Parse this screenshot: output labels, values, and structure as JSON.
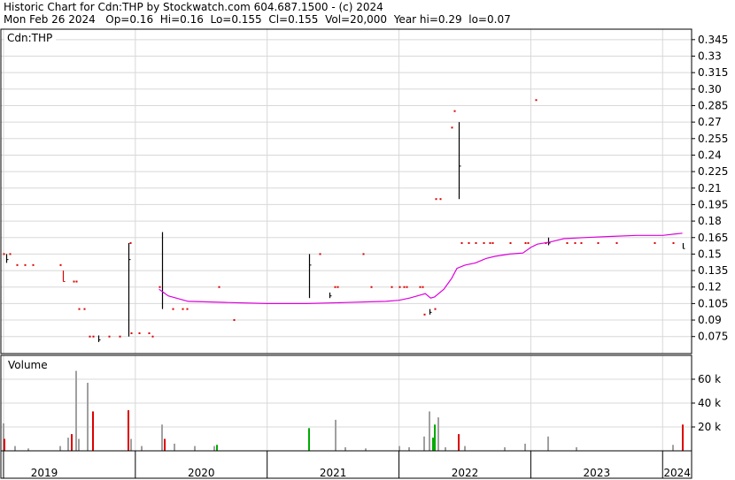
{
  "header": {
    "line1": "Historic Chart for Cdn:THP by Stockwatch.com 604.687.1500 - (c) 2024",
    "line2": "Mon Feb 26 2024   Op=0.16  Hi=0.16  Lo=0.155  Cl=0.155  Vol=20,000  Year hi=0.29  lo=0.07"
  },
  "colors": {
    "up": "#00aa00",
    "down": "#dd0000",
    "neutral": "#000000",
    "volume_neutral": "#a0a0a0",
    "moving_average": "#dd00dd",
    "grid": "#d8d8d8",
    "frame": "#000000"
  },
  "chart_data": [
    {
      "type": "line",
      "panel": "price",
      "label": "Cdn:THP",
      "y_ticks": [
        "0.345",
        "0.33",
        "0.315",
        "0.30",
        "0.285",
        "0.27",
        "0.255",
        "0.24",
        "0.225",
        "0.21",
        "0.195",
        "0.18",
        "0.165",
        "0.15",
        "0.135",
        "0.12",
        "0.105",
        "0.09",
        "0.075"
      ],
      "ylim": [
        0.0595,
        0.3545
      ],
      "xlim": [
        2018.98,
        2024.22
      ],
      "x_labels": [
        "2019",
        "2020",
        "2021",
        "2022",
        "2023",
        "2024"
      ],
      "year_boundaries": [
        2019,
        2020,
        2021,
        2022,
        2023,
        2024
      ],
      "grid": true,
      "bars": [
        {
          "t": 2019.0,
          "lo": 0.15,
          "hi": 0.15,
          "cl": 0.15,
          "dir": "down"
        },
        {
          "t": 2019.02,
          "lo": 0.142,
          "hi": 0.15,
          "cl": 0.145,
          "dir": "neutral"
        },
        {
          "t": 2019.05,
          "lo": 0.15,
          "hi": 0.15,
          "cl": 0.15,
          "dir": "down"
        },
        {
          "t": 2019.1,
          "lo": 0.14,
          "hi": 0.14,
          "cl": 0.14,
          "dir": "down"
        },
        {
          "t": 2019.16,
          "lo": 0.14,
          "hi": 0.14,
          "cl": 0.14,
          "dir": "down"
        },
        {
          "t": 2019.22,
          "lo": 0.14,
          "hi": 0.14,
          "cl": 0.14,
          "dir": "down"
        },
        {
          "t": 2019.43,
          "lo": 0.14,
          "hi": 0.14,
          "cl": 0.14,
          "dir": "down"
        },
        {
          "t": 2019.45,
          "lo": 0.125,
          "hi": 0.135,
          "cl": 0.125,
          "dir": "down"
        },
        {
          "t": 2019.53,
          "lo": 0.125,
          "hi": 0.125,
          "cl": 0.125,
          "dir": "down"
        },
        {
          "t": 2019.55,
          "lo": 0.125,
          "hi": 0.125,
          "cl": 0.125,
          "dir": "down"
        },
        {
          "t": 2019.57,
          "lo": 0.1,
          "hi": 0.1,
          "cl": 0.1,
          "dir": "down"
        },
        {
          "t": 2019.61,
          "lo": 0.1,
          "hi": 0.1,
          "cl": 0.1,
          "dir": "down"
        },
        {
          "t": 2019.65,
          "lo": 0.075,
          "hi": 0.075,
          "cl": 0.075,
          "dir": "down"
        },
        {
          "t": 2019.68,
          "lo": 0.075,
          "hi": 0.075,
          "cl": 0.075,
          "dir": "down"
        },
        {
          "t": 2019.72,
          "lo": 0.07,
          "hi": 0.076,
          "cl": 0.072,
          "dir": "neutral"
        },
        {
          "t": 2019.8,
          "lo": 0.075,
          "hi": 0.075,
          "cl": 0.075,
          "dir": "down"
        },
        {
          "t": 2019.88,
          "lo": 0.075,
          "hi": 0.075,
          "cl": 0.075,
          "dir": "down"
        },
        {
          "t": 2019.95,
          "lo": 0.075,
          "hi": 0.16,
          "cl": 0.145,
          "dir": "neutral"
        },
        {
          "t": 2019.96,
          "lo": 0.16,
          "hi": 0.16,
          "cl": 0.16,
          "dir": "down"
        },
        {
          "t": 2019.97,
          "lo": 0.078,
          "hi": 0.078,
          "cl": 0.078,
          "dir": "down"
        },
        {
          "t": 2020.03,
          "lo": 0.078,
          "hi": 0.078,
          "cl": 0.078,
          "dir": "down"
        },
        {
          "t": 2020.1,
          "lo": 0.078,
          "hi": 0.078,
          "cl": 0.078,
          "dir": "down"
        },
        {
          "t": 2020.13,
          "lo": 0.075,
          "hi": 0.075,
          "cl": 0.075,
          "dir": "down"
        },
        {
          "t": 2020.18,
          "lo": 0.12,
          "hi": 0.12,
          "cl": 0.12,
          "dir": "down"
        },
        {
          "t": 2020.2,
          "lo": 0.1,
          "hi": 0.17,
          "cl": 0.115,
          "dir": "neutral"
        },
        {
          "t": 2020.28,
          "lo": 0.1,
          "hi": 0.1,
          "cl": 0.1,
          "dir": "down"
        },
        {
          "t": 2020.36,
          "lo": 0.1,
          "hi": 0.1,
          "cl": 0.1,
          "dir": "down"
        },
        {
          "t": 2020.39,
          "lo": 0.1,
          "hi": 0.1,
          "cl": 0.1,
          "dir": "down"
        },
        {
          "t": 2020.63,
          "lo": 0.12,
          "hi": 0.12,
          "cl": 0.12,
          "dir": "down"
        },
        {
          "t": 2020.75,
          "lo": 0.09,
          "hi": 0.09,
          "cl": 0.09,
          "dir": "down"
        },
        {
          "t": 2021.32,
          "lo": 0.11,
          "hi": 0.15,
          "cl": 0.14,
          "dir": "neutral"
        },
        {
          "t": 2021.4,
          "lo": 0.15,
          "hi": 0.15,
          "cl": 0.15,
          "dir": "down"
        },
        {
          "t": 2021.47,
          "lo": 0.11,
          "hi": 0.115,
          "cl": 0.112,
          "dir": "neutral"
        },
        {
          "t": 2021.51,
          "lo": 0.12,
          "hi": 0.12,
          "cl": 0.12,
          "dir": "down"
        },
        {
          "t": 2021.53,
          "lo": 0.12,
          "hi": 0.12,
          "cl": 0.12,
          "dir": "down"
        },
        {
          "t": 2021.73,
          "lo": 0.15,
          "hi": 0.15,
          "cl": 0.15,
          "dir": "down"
        },
        {
          "t": 2021.79,
          "lo": 0.12,
          "hi": 0.12,
          "cl": 0.12,
          "dir": "down"
        },
        {
          "t": 2021.94,
          "lo": 0.12,
          "hi": 0.12,
          "cl": 0.12,
          "dir": "down"
        },
        {
          "t": 2022.0,
          "lo": 0.12,
          "hi": 0.12,
          "cl": 0.12,
          "dir": "down"
        },
        {
          "t": 2022.04,
          "lo": 0.12,
          "hi": 0.12,
          "cl": 0.12,
          "dir": "down"
        },
        {
          "t": 2022.06,
          "lo": 0.12,
          "hi": 0.12,
          "cl": 0.12,
          "dir": "down"
        },
        {
          "t": 2022.16,
          "lo": 0.12,
          "hi": 0.12,
          "cl": 0.12,
          "dir": "down"
        },
        {
          "t": 2022.18,
          "lo": 0.12,
          "hi": 0.12,
          "cl": 0.12,
          "dir": "down"
        },
        {
          "t": 2022.19,
          "lo": 0.095,
          "hi": 0.095,
          "cl": 0.095,
          "dir": "down"
        },
        {
          "t": 2022.23,
          "lo": 0.095,
          "hi": 0.1,
          "cl": 0.097,
          "dir": "neutral"
        },
        {
          "t": 2022.27,
          "lo": 0.1,
          "hi": 0.1,
          "cl": 0.1,
          "dir": "down"
        },
        {
          "t": 2022.28,
          "lo": 0.2,
          "hi": 0.2,
          "cl": 0.2,
          "dir": "down"
        },
        {
          "t": 2022.31,
          "lo": 0.2,
          "hi": 0.2,
          "cl": 0.2,
          "dir": "down"
        },
        {
          "t": 2022.4,
          "lo": 0.265,
          "hi": 0.265,
          "cl": 0.265,
          "dir": "down"
        },
        {
          "t": 2022.42,
          "lo": 0.28,
          "hi": 0.28,
          "cl": 0.28,
          "dir": "down"
        },
        {
          "t": 2022.45,
          "lo": 0.2,
          "hi": 0.27,
          "cl": 0.23,
          "dir": "neutral"
        },
        {
          "t": 2022.47,
          "lo": 0.16,
          "hi": 0.16,
          "cl": 0.16,
          "dir": "down"
        },
        {
          "t": 2022.53,
          "lo": 0.16,
          "hi": 0.16,
          "cl": 0.16,
          "dir": "down"
        },
        {
          "t": 2022.58,
          "lo": 0.16,
          "hi": 0.16,
          "cl": 0.16,
          "dir": "down"
        },
        {
          "t": 2022.64,
          "lo": 0.16,
          "hi": 0.16,
          "cl": 0.16,
          "dir": "down"
        },
        {
          "t": 2022.69,
          "lo": 0.16,
          "hi": 0.16,
          "cl": 0.16,
          "dir": "down"
        },
        {
          "t": 2022.71,
          "lo": 0.16,
          "hi": 0.16,
          "cl": 0.16,
          "dir": "down"
        },
        {
          "t": 2022.84,
          "lo": 0.16,
          "hi": 0.16,
          "cl": 0.16,
          "dir": "down"
        },
        {
          "t": 2022.96,
          "lo": 0.16,
          "hi": 0.16,
          "cl": 0.16,
          "dir": "down"
        },
        {
          "t": 2022.98,
          "lo": 0.16,
          "hi": 0.16,
          "cl": 0.16,
          "dir": "down"
        },
        {
          "t": 2023.04,
          "lo": 0.29,
          "hi": 0.29,
          "cl": 0.29,
          "dir": "down"
        },
        {
          "t": 2023.11,
          "lo": 0.16,
          "hi": 0.16,
          "cl": 0.16,
          "dir": "down"
        },
        {
          "t": 2023.13,
          "lo": 0.158,
          "hi": 0.165,
          "cl": 0.16,
          "dir": "neutral"
        },
        {
          "t": 2023.27,
          "lo": 0.16,
          "hi": 0.16,
          "cl": 0.16,
          "dir": "down"
        },
        {
          "t": 2023.33,
          "lo": 0.16,
          "hi": 0.16,
          "cl": 0.16,
          "dir": "down"
        },
        {
          "t": 2023.38,
          "lo": 0.16,
          "hi": 0.16,
          "cl": 0.16,
          "dir": "down"
        },
        {
          "t": 2023.51,
          "lo": 0.16,
          "hi": 0.16,
          "cl": 0.16,
          "dir": "down"
        },
        {
          "t": 2023.65,
          "lo": 0.16,
          "hi": 0.16,
          "cl": 0.16,
          "dir": "down"
        },
        {
          "t": 2023.94,
          "lo": 0.16,
          "hi": 0.16,
          "cl": 0.16,
          "dir": "down"
        },
        {
          "t": 2024.08,
          "lo": 0.16,
          "hi": 0.16,
          "cl": 0.16,
          "dir": "down"
        },
        {
          "t": 2024.15,
          "lo": 0.155,
          "hi": 0.16,
          "cl": 0.155,
          "dir": "neutral"
        }
      ],
      "moving_average": [
        {
          "t": 2020.18,
          "v": 0.118
        },
        {
          "t": 2020.25,
          "v": 0.112
        },
        {
          "t": 2020.4,
          "v": 0.107
        },
        {
          "t": 2020.7,
          "v": 0.106
        },
        {
          "t": 2021.0,
          "v": 0.105
        },
        {
          "t": 2021.3,
          "v": 0.105
        },
        {
          "t": 2021.6,
          "v": 0.106
        },
        {
          "t": 2021.9,
          "v": 0.107
        },
        {
          "t": 2022.0,
          "v": 0.108
        },
        {
          "t": 2022.08,
          "v": 0.11
        },
        {
          "t": 2022.14,
          "v": 0.112
        },
        {
          "t": 2022.2,
          "v": 0.114
        },
        {
          "t": 2022.24,
          "v": 0.11
        },
        {
          "t": 2022.27,
          "v": 0.111
        },
        {
          "t": 2022.34,
          "v": 0.118
        },
        {
          "t": 2022.4,
          "v": 0.128
        },
        {
          "t": 2022.44,
          "v": 0.137
        },
        {
          "t": 2022.5,
          "v": 0.14
        },
        {
          "t": 2022.58,
          "v": 0.142
        },
        {
          "t": 2022.66,
          "v": 0.146
        },
        {
          "t": 2022.73,
          "v": 0.148
        },
        {
          "t": 2022.84,
          "v": 0.15
        },
        {
          "t": 2022.94,
          "v": 0.151
        },
        {
          "t": 2023.0,
          "v": 0.156
        },
        {
          "t": 2023.05,
          "v": 0.159
        },
        {
          "t": 2023.15,
          "v": 0.161
        },
        {
          "t": 2023.25,
          "v": 0.164
        },
        {
          "t": 2023.4,
          "v": 0.165
        },
        {
          "t": 2023.6,
          "v": 0.166
        },
        {
          "t": 2023.8,
          "v": 0.167
        },
        {
          "t": 2024.0,
          "v": 0.167
        },
        {
          "t": 2024.15,
          "v": 0.169
        }
      ]
    },
    {
      "type": "bar",
      "panel": "volume",
      "label": "Volume",
      "y_ticks": [
        "60 k",
        "40 k",
        "20 k"
      ],
      "ylim": [
        0,
        80000
      ],
      "xlim": [
        2018.98,
        2024.22
      ],
      "bars": [
        {
          "t": 2019.0,
          "v": 23000,
          "dir": "neutral"
        },
        {
          "t": 2019.01,
          "v": 10000,
          "dir": "down"
        },
        {
          "t": 2019.09,
          "v": 4000,
          "dir": "neutral"
        },
        {
          "t": 2019.19,
          "v": 2000,
          "dir": "neutral"
        },
        {
          "t": 2019.43,
          "v": 4000,
          "dir": "neutral"
        },
        {
          "t": 2019.49,
          "v": 11000,
          "dir": "neutral"
        },
        {
          "t": 2019.52,
          "v": 14000,
          "dir": "down"
        },
        {
          "t": 2019.55,
          "v": 67000,
          "dir": "neutral"
        },
        {
          "t": 2019.57,
          "v": 10000,
          "dir": "neutral"
        },
        {
          "t": 2019.64,
          "v": 57000,
          "dir": "neutral"
        },
        {
          "t": 2019.68,
          "v": 33000,
          "dir": "down"
        },
        {
          "t": 2019.95,
          "v": 34000,
          "dir": "down"
        },
        {
          "t": 2019.97,
          "v": 10000,
          "dir": "neutral"
        },
        {
          "t": 2020.05,
          "v": 4000,
          "dir": "neutral"
        },
        {
          "t": 2020.2,
          "v": 22000,
          "dir": "neutral"
        },
        {
          "t": 2020.22,
          "v": 10000,
          "dir": "down"
        },
        {
          "t": 2020.3,
          "v": 6000,
          "dir": "neutral"
        },
        {
          "t": 2020.45,
          "v": 4000,
          "dir": "neutral"
        },
        {
          "t": 2020.6,
          "v": 4000,
          "dir": "neutral"
        },
        {
          "t": 2020.62,
          "v": 5000,
          "dir": "up"
        },
        {
          "t": 2021.32,
          "v": 19000,
          "dir": "up"
        },
        {
          "t": 2021.52,
          "v": 26000,
          "dir": "neutral"
        },
        {
          "t": 2021.59,
          "v": 3000,
          "dir": "neutral"
        },
        {
          "t": 2021.75,
          "v": 2000,
          "dir": "neutral"
        },
        {
          "t": 2022.0,
          "v": 4000,
          "dir": "neutral"
        },
        {
          "t": 2022.08,
          "v": 3000,
          "dir": "neutral"
        },
        {
          "t": 2022.19,
          "v": 12000,
          "dir": "neutral"
        },
        {
          "t": 2022.23,
          "v": 33000,
          "dir": "neutral"
        },
        {
          "t": 2022.26,
          "v": 11000,
          "dir": "up"
        },
        {
          "t": 2022.27,
          "v": 22000,
          "dir": "up"
        },
        {
          "t": 2022.3,
          "v": 28000,
          "dir": "neutral"
        },
        {
          "t": 2022.35,
          "v": 3000,
          "dir": "neutral"
        },
        {
          "t": 2022.45,
          "v": 14000,
          "dir": "down"
        },
        {
          "t": 2022.5,
          "v": 4000,
          "dir": "neutral"
        },
        {
          "t": 2022.8,
          "v": 3000,
          "dir": "neutral"
        },
        {
          "t": 2022.96,
          "v": 6000,
          "dir": "neutral"
        },
        {
          "t": 2023.13,
          "v": 12000,
          "dir": "neutral"
        },
        {
          "t": 2023.35,
          "v": 3000,
          "dir": "neutral"
        },
        {
          "t": 2024.08,
          "v": 5000,
          "dir": "neutral"
        },
        {
          "t": 2024.15,
          "v": 22000,
          "dir": "down"
        }
      ]
    }
  ]
}
